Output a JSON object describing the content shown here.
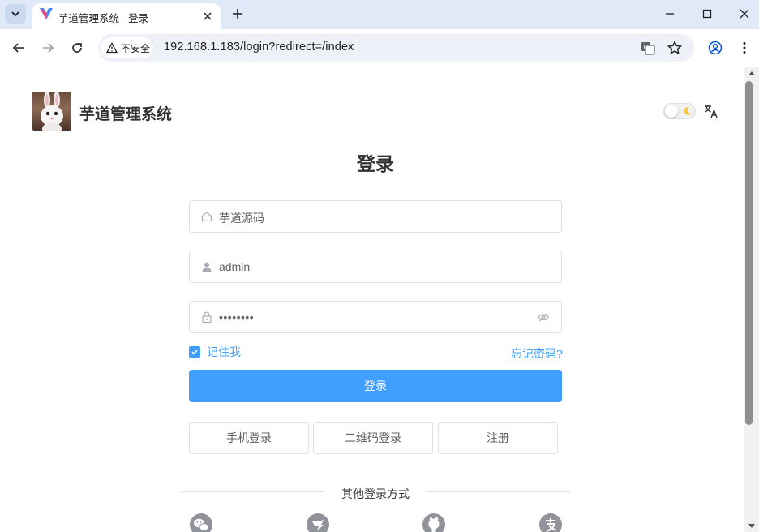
{
  "browser": {
    "tab_title": "芋道管理系统 - 登录",
    "security_label": "不安全",
    "url": "192.168.1.183/login?redirect=/index"
  },
  "header": {
    "brand": "芋道管理系统"
  },
  "login": {
    "title": "登录",
    "tenant_value": "芋道源码",
    "username_value": "admin",
    "password_value": "••••••••",
    "remember_label": "记住我",
    "remember_checked": true,
    "forgot_label": "忘记密码?",
    "submit_label": "登录"
  },
  "alt_login": [
    {
      "label": "手机登录"
    },
    {
      "label": "二维码登录"
    },
    {
      "label": "注册"
    }
  ],
  "other_methods": {
    "label": "其他登录方式",
    "icons": [
      "wechat-icon",
      "dingtalk-icon",
      "github-icon",
      "alipay-icon"
    ]
  },
  "colors": {
    "primary": "#409eff",
    "tabbar": "#dfe9f8"
  }
}
